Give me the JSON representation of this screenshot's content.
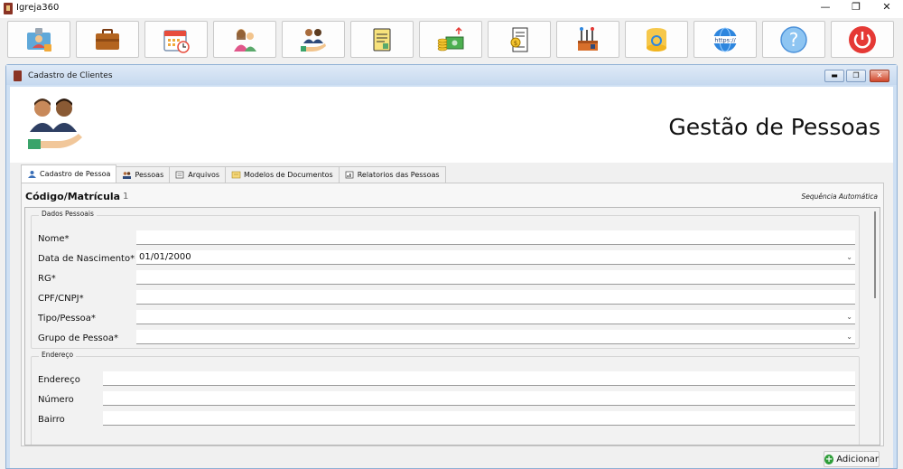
{
  "app": {
    "title": "Igreja360",
    "minimize": "—",
    "maximize": "❐",
    "close": "✕"
  },
  "toolbar": {
    "buttons": [
      {
        "name": "member-card-icon"
      },
      {
        "name": "briefcase-icon"
      },
      {
        "name": "calendar-icon"
      },
      {
        "name": "family-icon"
      },
      {
        "name": "people-hands-icon"
      },
      {
        "name": "documents-icon"
      },
      {
        "name": "money-icon"
      },
      {
        "name": "receipt-icon"
      },
      {
        "name": "tools-icon"
      },
      {
        "name": "database-icon"
      },
      {
        "name": "web-icon",
        "text": "https://"
      },
      {
        "name": "help-icon",
        "text": "?"
      },
      {
        "name": "power-icon"
      }
    ]
  },
  "child_window": {
    "title": "Cadastro de Clientes",
    "min": "▬",
    "restore": "❐",
    "close": "✕"
  },
  "header": {
    "title": "Gestão de Pessoas"
  },
  "tabs": [
    {
      "label": "Cadastro de Pessoa",
      "active": true
    },
    {
      "label": "Pessoas"
    },
    {
      "label": "Arquivos"
    },
    {
      "label": "Modelos de Documentos"
    },
    {
      "label": "Relatorios das Pessoas"
    }
  ],
  "form": {
    "code_label": "Código/Matrícula",
    "code_value": "1",
    "code_note": "Sequência Automática",
    "dados_pessoais": {
      "title": "Dados Pessoais",
      "nome_label": "Nome*",
      "nome_value": "",
      "nascimento_label": "Data de Nascimento*",
      "nascimento_value": "01/01/2000",
      "rg_label": "RG*",
      "rg_value": "",
      "cpf_label": "CPF/CNPJ*",
      "cpf_value": "",
      "tipo_label": "Tipo/Pessoa*",
      "tipo_value": "",
      "grupo_label": "Grupo de Pessoa*",
      "grupo_value": ""
    },
    "endereco": {
      "title": "Endereço",
      "endereco_label": "Endereço",
      "endereco_value": "",
      "numero_label": "Número",
      "numero_value": "",
      "bairro_label": "Bairro",
      "bairro_value": ""
    },
    "add_button": "Adicionar"
  }
}
